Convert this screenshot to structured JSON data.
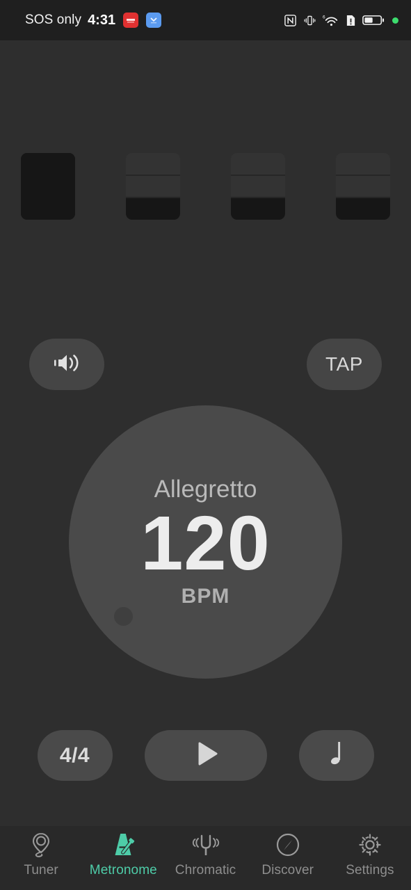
{
  "status_bar": {
    "carrier": "SOS only",
    "time": "4:31",
    "notifications": [
      {
        "name": "notification-badge-red",
        "color": "#e03131"
      },
      {
        "name": "notification-badge-blue",
        "color": "#5b9bf0"
      }
    ],
    "icons": [
      "nfc-icon",
      "vibrate-icon",
      "wifi-6-icon",
      "sim-alert-icon",
      "battery-icon",
      "green-dot-indicator"
    ]
  },
  "metronome": {
    "beats": [
      {
        "index": 1,
        "accented": true,
        "subdivisions_filled": 3,
        "subdivisions_total": 3
      },
      {
        "index": 2,
        "accented": false,
        "subdivisions_filled": 1,
        "subdivisions_total": 3
      },
      {
        "index": 3,
        "accented": false,
        "subdivisions_filled": 1,
        "subdivisions_total": 3
      },
      {
        "index": 4,
        "accented": false,
        "subdivisions_filled": 1,
        "subdivisions_total": 3
      }
    ],
    "volume_button": {
      "icon": "volume-up-icon"
    },
    "tap_button": {
      "label": "TAP"
    },
    "dial": {
      "tempo_name": "Allegretto",
      "bpm": "120",
      "unit": "BPM"
    },
    "controls": {
      "time_signature": "4/4",
      "play_icon": "play-icon",
      "subdivision_icon": "quarter-note-icon"
    }
  },
  "bottom_nav": {
    "active_color": "#4ecca8",
    "items": [
      {
        "label": "Tuner",
        "icon": "tuning-peg-icon",
        "active": false
      },
      {
        "label": "Metronome",
        "icon": "metronome-icon",
        "active": true
      },
      {
        "label": "Chromatic",
        "icon": "tuning-fork-icon",
        "active": false
      },
      {
        "label": "Discover",
        "icon": "compass-icon",
        "active": false
      },
      {
        "label": "Settings",
        "icon": "gear-icon",
        "active": false
      }
    ]
  }
}
